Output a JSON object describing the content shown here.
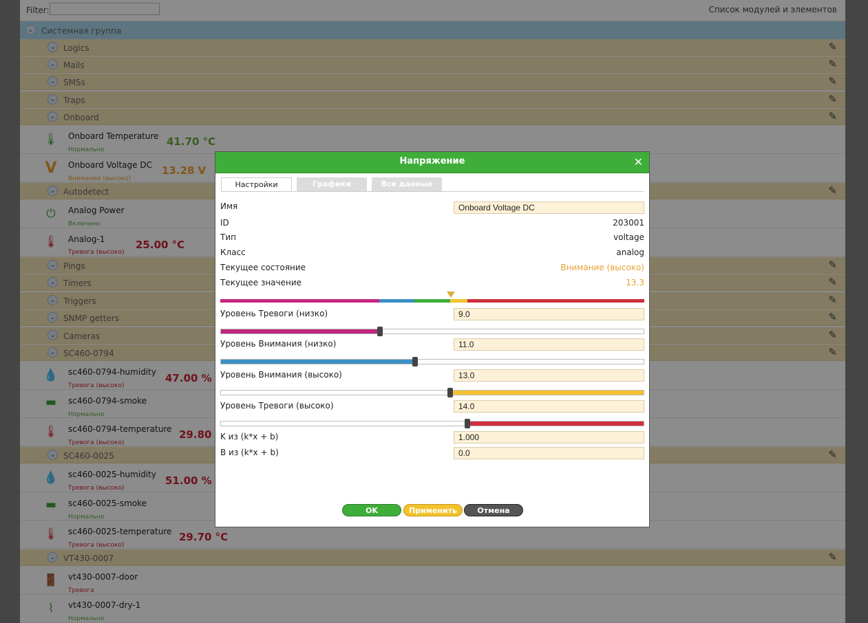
{
  "topbar": {
    "filter_label": "Filter:",
    "filter_value": "",
    "list_title": "Список модулей и элементов"
  },
  "groups": {
    "system": "Системная группа",
    "logics": "Logics",
    "mails": "Mails",
    "smss": "SMSs",
    "traps": "Traps",
    "onboard": "Onboard",
    "autodetect": "Autodetect",
    "pings": "Pings",
    "timers": "Timers",
    "triggers": "Triggers",
    "snmp": "SNMP getters",
    "cameras": "Cameras",
    "sc460_0794": "SC460-0794",
    "sc460_0025": "SC460-0025",
    "vt430_0007": "VT430-0007"
  },
  "items": {
    "onboard_temp": {
      "name": "Onboard Temperature",
      "status": "Нормально",
      "value": "41.70 °C"
    },
    "onboard_voltage": {
      "name": "Onboard Voltage DC",
      "status": "Внимание (высоко)",
      "value": "13.28 V"
    },
    "analog_power": {
      "name": "Analog Power",
      "status": "Включено"
    },
    "analog_1": {
      "name": "Analog-1",
      "status": "Тревога (высоко)",
      "value": "25.00 °C"
    },
    "sc0794_hum": {
      "name": "sc460-0794-humidity",
      "status": "Тревога (высоко)",
      "value": "47.00 %"
    },
    "sc0794_smoke": {
      "name": "sc460-0794-smoke",
      "status": "Нормально"
    },
    "sc0794_temp": {
      "name": "sc460-0794-temperature",
      "status": "Тревога (высоко)",
      "value": "29.80 °"
    },
    "sc0025_hum": {
      "name": "sc460-0025-humidity",
      "status": "Тревога (высоко)",
      "value": "51.00 %"
    },
    "sc0025_smoke": {
      "name": "sc460-0025-smoke",
      "status": "Нормально"
    },
    "sc0025_temp": {
      "name": "sc460-0025-temperature",
      "status": "Тревога (высоко)",
      "value": "29.70 °C"
    },
    "vt_door": {
      "name": "vt430-0007-door",
      "status": "Тревога"
    },
    "vt_dry": {
      "name": "vt430-0007-dry-1",
      "status": "Нормально"
    }
  },
  "dialog": {
    "title": "Напряжение",
    "tabs": [
      "Настройки",
      "Графики",
      "Все данные"
    ],
    "fields": {
      "name_label": "Имя",
      "name_value": "Onboard Voltage DC",
      "id_label": "ID",
      "id_value": "203001",
      "type_label": "Тип",
      "type_value": "voltage",
      "class_label": "Класс",
      "class_value": "analog",
      "state_label": "Текущее состояние",
      "state_value": "Внимание (высоко)",
      "current_label": "Текущее значение",
      "current_value": "13.3",
      "alarm_low_label": "Уровень Тревоги (низко)",
      "alarm_low_value": "9.0",
      "warn_low_label": "Уровень Внимания (низко)",
      "warn_low_value": "11.0",
      "warn_high_label": "Уровень Внимания (высоко)",
      "warn_high_value": "13.0",
      "alarm_high_label": "Уровень Тревоги (высоко)",
      "alarm_high_value": "14.0",
      "k_label": "K из (k*x + b)",
      "k_value": "1.000",
      "b_label": "B из (k*x + b)",
      "b_value": "0.0"
    },
    "buttons": {
      "ok": "OK",
      "apply": "Применить",
      "cancel": "Отмена"
    }
  },
  "colors": {
    "alarm_low": "#c2267e",
    "warn_low": "#3d8fc6",
    "normal": "#3fad3a",
    "warn_high": "#f3c22d",
    "alarm_high": "#cf2e3d",
    "header": "#3fad3a"
  }
}
